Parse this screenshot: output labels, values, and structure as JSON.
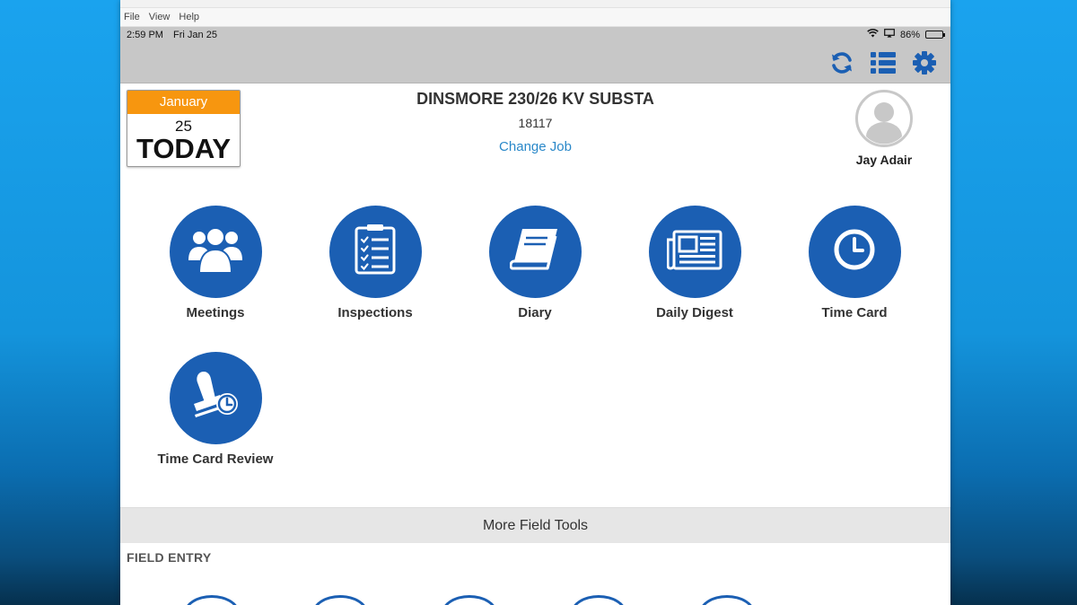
{
  "window": {
    "menu": [
      "File",
      "View",
      "Help"
    ]
  },
  "status": {
    "time": "2:59 PM",
    "date": "Fri Jan 25",
    "battery": "86%",
    "battery_level": 0.86
  },
  "toolbar": {
    "icons": [
      "sync-icon",
      "list-icon",
      "gear-icon"
    ]
  },
  "calendar": {
    "month": "January",
    "day": "25",
    "label": "TODAY"
  },
  "job": {
    "title": "DINSMORE 230/26 KV SUBSTA",
    "number": "18117",
    "change_link": "Change Job"
  },
  "user": {
    "name": "Jay Adair"
  },
  "tools": [
    {
      "label": "Meetings",
      "icon": "people-icon"
    },
    {
      "label": "Inspections",
      "icon": "checklist-icon"
    },
    {
      "label": "Diary",
      "icon": "book-icon"
    },
    {
      "label": "Daily Digest",
      "icon": "newspaper-icon"
    },
    {
      "label": "Time Card",
      "icon": "clock-icon"
    },
    {
      "label": "Time Card Review",
      "icon": "stamp-clock-icon"
    }
  ],
  "more": {
    "label": "More Field Tools"
  },
  "section": {
    "label": "FIELD ENTRY"
  },
  "colors": {
    "accent": "#1b5fb3",
    "link": "#2a88c9",
    "calendar_header": "#f7960f",
    "bar_gray": "#c7c7c7"
  }
}
